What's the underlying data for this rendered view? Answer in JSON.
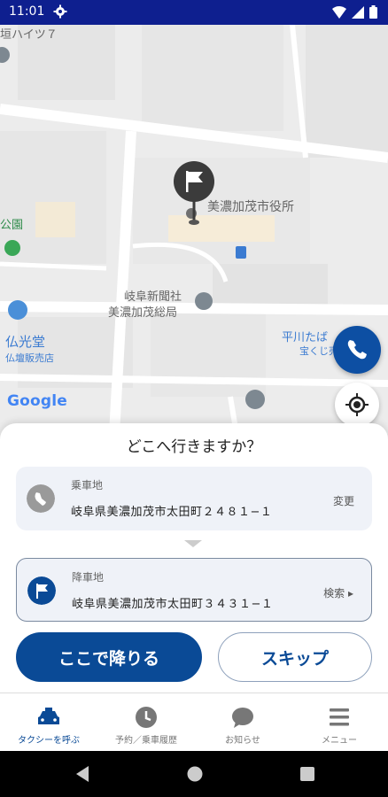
{
  "status_bar": {
    "time": "11:01",
    "icons": [
      "gear-icon",
      "wifi-icon",
      "signal-icon",
      "battery-icon"
    ]
  },
  "map": {
    "labels": {
      "top_left": "垣ハイツ７",
      "city_hall": "美濃加茂市役所",
      "park": "公園",
      "newspaper_1": "岐阜新聞社",
      "newspaper_2": "美濃加茂総局",
      "shop_1": "仏光堂",
      "shop_2": "仏壇販売店",
      "shop_right_1": "平川たば",
      "shop_right_2": "宝くじ売り"
    },
    "google_logo": "Google"
  },
  "sheet": {
    "title": "どこへ行きますか？",
    "pickup": {
      "label": "乗車地",
      "value": "岐阜県美濃加茂市太田町２４８１−１",
      "action": "変更"
    },
    "dropoff": {
      "label": "降車地",
      "value": "岐阜県美濃加茂市太田町３４３１−１",
      "action": "検索 ▸"
    },
    "primary_button": "ここで降りる",
    "secondary_button": "スキップ"
  },
  "bottom_nav": [
    {
      "label": "タクシーを呼ぶ",
      "icon": "taxi-icon"
    },
    {
      "label": "予約／乗車履歴",
      "icon": "clock-icon"
    },
    {
      "label": "お知らせ",
      "icon": "chat-icon"
    },
    {
      "label": "メニュー",
      "icon": "menu-icon"
    }
  ],
  "colors": {
    "status_bar": "#0e1f8f",
    "primary": "#0a4a96",
    "phone_fab": "#0d4fa3"
  }
}
